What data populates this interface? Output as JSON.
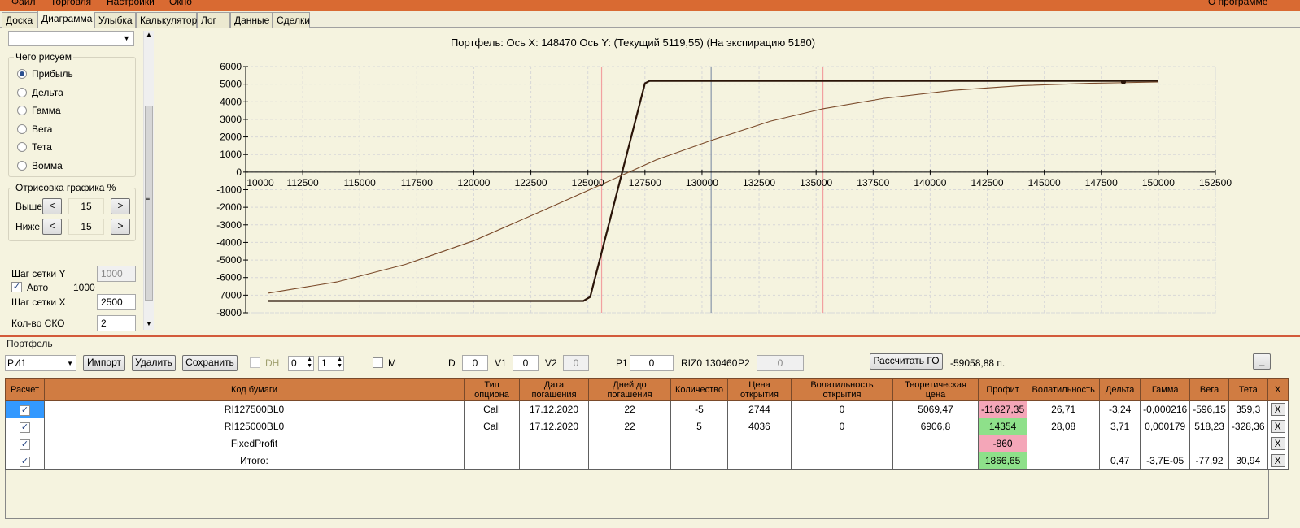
{
  "menu": [
    "Файл",
    "Торговля",
    "Настройки",
    "Окно"
  ],
  "about": "О программе",
  "tabs": [
    "Доска",
    "Диаграмма",
    "Улыбка",
    "Калькулятор",
    "Лог",
    "Данные",
    "Сделки"
  ],
  "left": {
    "draw_group": "Чего рисуем",
    "radios": [
      {
        "label": "Прибыль",
        "checked": true
      },
      {
        "label": "Дельта",
        "checked": false
      },
      {
        "label": "Гамма",
        "checked": false
      },
      {
        "label": "Вега",
        "checked": false
      },
      {
        "label": "Тета",
        "checked": false
      },
      {
        "label": "Вомма",
        "checked": false
      }
    ],
    "range_group": "Отрисовка графика %",
    "above_label": "Выше",
    "below_label": "Ниже",
    "above_value": "15",
    "below_value": "15",
    "btn_less": "<",
    "btn_more": ">",
    "grid_y_label": "Шаг сетки Y",
    "grid_y_value": "1000",
    "auto_label": "Авто",
    "auto_value": "1000",
    "grid_x_label": "Шаг сетки X",
    "grid_x_value": "2500",
    "sko_label": "Кол-во СКО",
    "sko_value": "2",
    "scroll_grip": "≡"
  },
  "chart_data": {
    "type": "line",
    "title": "Портфель:  Ось X:  148470  Ось Y:   (Текущий 5119,55)   (На экспирацию 5180)",
    "xlim": [
      110000,
      152500
    ],
    "ylim": [
      -8000,
      6000
    ],
    "x_ticks": [
      "10000",
      "112500",
      "115000",
      "117500",
      "120000",
      "122500",
      "125000",
      "127500",
      "130000",
      "132500",
      "135000",
      "137500",
      "140000",
      "142500",
      "145000",
      "147500",
      "150000",
      "152500"
    ],
    "y_ticks": [
      "6000",
      "5000",
      "4000",
      "3000",
      "2000",
      "1000",
      "0",
      "-1000",
      "-2000",
      "-3000",
      "-4000",
      "-5000",
      "-6000",
      "-7000",
      "-8000"
    ],
    "vlines": [
      {
        "x": 125600,
        "color": "#f2a0a0"
      },
      {
        "x": 130400,
        "color": "#8895a8"
      },
      {
        "x": 135300,
        "color": "#f2a0a0"
      }
    ],
    "series": [
      {
        "color": "#2a1408",
        "points": [
          [
            111000,
            -7330
          ],
          [
            124800,
            -7330
          ],
          [
            125100,
            -7100
          ],
          [
            127500,
            5050
          ],
          [
            127700,
            5180
          ],
          [
            150000,
            5180
          ]
        ]
      },
      {
        "color": "#7a4a2a",
        "points": [
          [
            111000,
            -6880
          ],
          [
            114000,
            -6250
          ],
          [
            117000,
            -5250
          ],
          [
            120000,
            -3900
          ],
          [
            123000,
            -2200
          ],
          [
            125600,
            -700
          ],
          [
            128000,
            700
          ],
          [
            130400,
            1800
          ],
          [
            133000,
            2900
          ],
          [
            135300,
            3600
          ],
          [
            138000,
            4200
          ],
          [
            141000,
            4650
          ],
          [
            144000,
            4920
          ],
          [
            147000,
            5050
          ],
          [
            150000,
            5120
          ]
        ]
      }
    ],
    "marker": {
      "x": 148470,
      "y": 5119.55
    }
  },
  "portfolio": {
    "label": "Портфель",
    "selected": "РИ1",
    "import": "Импорт",
    "delete": "Удалить",
    "save": "Сохранить",
    "dh_label": "DH",
    "spin1": "0",
    "spin2": "1",
    "m_label": "M",
    "d_label": "D",
    "d_value": "0",
    "v1_label": "V1",
    "v1_value": "0",
    "v2_label": "V2",
    "v2_value": "0",
    "p1_label": "P1",
    "p1_value": "0",
    "riz": "RIZ0 130460",
    "p2_label": "P2",
    "p2_value": "0",
    "calc_go": "Рассчитать ГО",
    "go_value": "-59058,88 п.",
    "minimize": "_"
  },
  "table": {
    "headers": [
      "Расчет",
      "Код бумаги",
      "Тип опциона",
      "Дата погашения",
      "Дней до погашения",
      "Количество",
      "Цена открытия",
      "Волатильность открытия",
      "Теоретическая цена",
      "Профит",
      "Волатильность",
      "Дельта",
      "Гамма",
      "Вега",
      "Тета",
      "X"
    ],
    "rows": [
      [
        "✓",
        "RI127500BL0",
        "Call",
        "17.12.2020",
        "22",
        "-5",
        "2744",
        "0",
        "5069,47",
        "-11627,35",
        "26,71",
        "-3,24",
        "-0,000216",
        "-596,15",
        "359,3",
        "X"
      ],
      [
        "✓",
        "RI125000BL0",
        "Call",
        "17.12.2020",
        "22",
        "5",
        "4036",
        "0",
        "6906,8",
        "14354",
        "28,08",
        "3,71",
        "0,000179",
        "518,23",
        "-328,36",
        "X"
      ],
      [
        "✓",
        "FixedProfit",
        "",
        "",
        "",
        "",
        "",
        "",
        "",
        "-860",
        "",
        "",
        "",
        "",
        "",
        "X"
      ],
      [
        "✓",
        "Итого:",
        "",
        "",
        "",
        "",
        "",
        "",
        "",
        "1866,65",
        "",
        "0,47",
        "-3,7E-05",
        "-77,92",
        "30,94",
        "X"
      ]
    ],
    "profit_colors": [
      "pink",
      "green",
      "pink",
      "green"
    ]
  }
}
